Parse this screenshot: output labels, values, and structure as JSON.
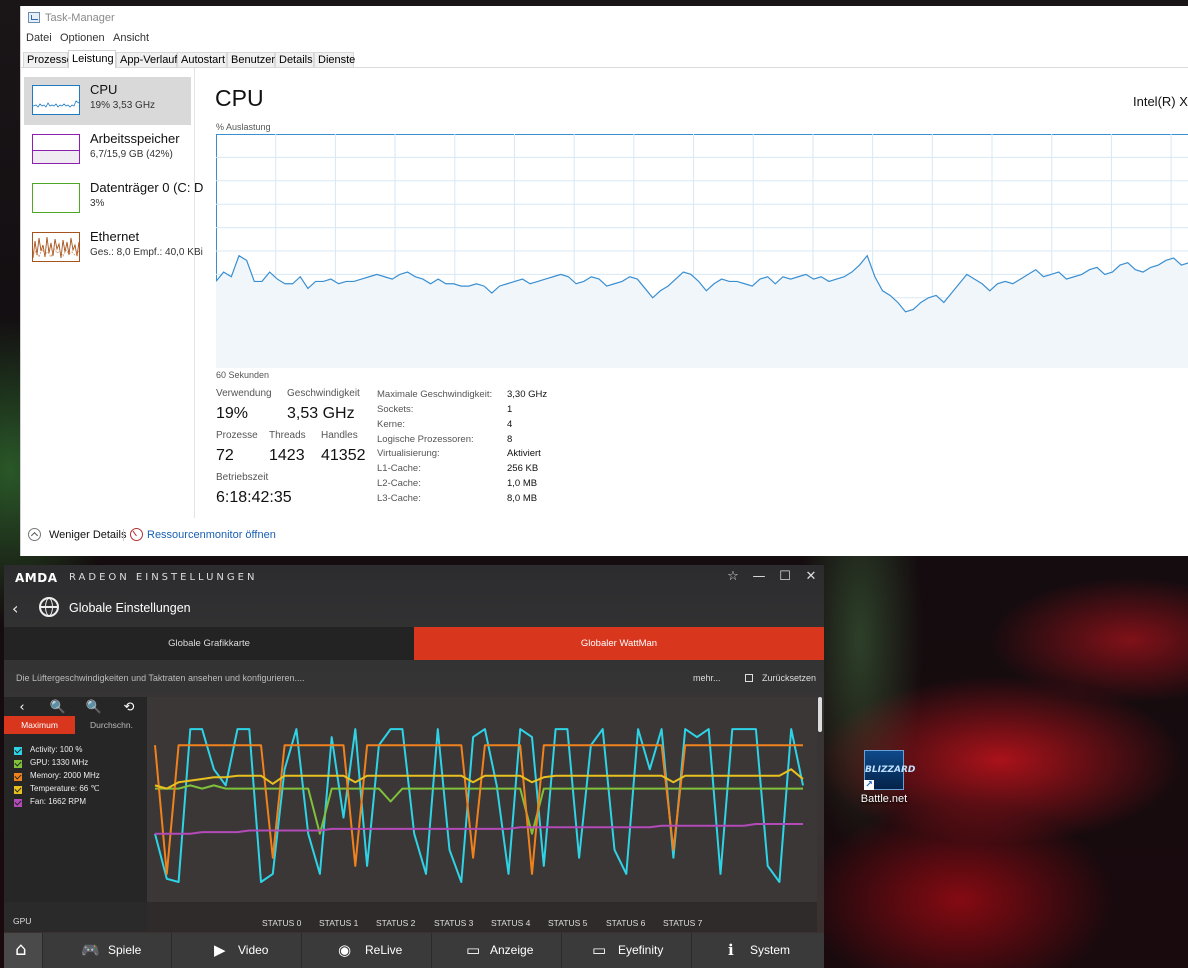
{
  "desktop": {
    "icon_label": "Battle.net",
    "icon_logo_text": "BLIZZARD"
  },
  "taskmanager": {
    "title": "Task-Manager",
    "menu": [
      "Datei",
      "Optionen",
      "Ansicht"
    ],
    "tabs": [
      "Prozesse",
      "Leistung",
      "App-Verlauf",
      "Autostart",
      "Benutzer",
      "Details",
      "Dienste"
    ],
    "active_tab": "Leistung",
    "sidebar": [
      {
        "name": "CPU",
        "sub": "19% 3,53 GHz",
        "color": "#1f7ac6"
      },
      {
        "name": "Arbeitsspeicher",
        "sub": "6,7/15,9 GB (42%)",
        "color": "#8b1fb1"
      },
      {
        "name": "Datenträger 0 (C: D",
        "sub": "3%",
        "color": "#4ea826"
      },
      {
        "name": "Ethernet",
        "sub": "Ges.: 8,0  Empf.: 40,0 KBi",
        "color": "#a6531c"
      }
    ],
    "cpu": {
      "title": "CPU",
      "model": "Intel(R) Xe",
      "y_label": "% Auslastung",
      "x_label": "60 Sekunden",
      "graph_line_color": "#3a8fd1",
      "stats": {
        "usage_label": "Verwendung",
        "usage_value": "19%",
        "speed_label": "Geschwindigkeit",
        "speed_value": "3,53 GHz",
        "processes_label": "Prozesse",
        "processes_value": "72",
        "threads_label": "Threads",
        "threads_value": "1423",
        "handles_label": "Handles",
        "handles_value": "41352",
        "uptime_label": "Betriebszeit",
        "uptime_value": "6:18:42:35"
      },
      "specs": [
        {
          "k": "Maximale Geschwindigkeit:",
          "v": "3,30 GHz"
        },
        {
          "k": "Sockets:",
          "v": "1"
        },
        {
          "k": "Kerne:",
          "v": "4"
        },
        {
          "k": "Logische Prozessoren:",
          "v": "8"
        },
        {
          "k": "Virtualisierung:",
          "v": "Aktiviert"
        },
        {
          "k": "L1-Cache:",
          "v": "256 KB"
        },
        {
          "k": "L2-Cache:",
          "v": "1,0 MB"
        },
        {
          "k": "L3-Cache:",
          "v": "8,0 MB"
        }
      ],
      "history_percent": [
        37,
        41,
        39,
        48,
        46,
        37,
        37,
        41,
        38,
        36,
        36,
        39,
        34,
        37,
        37,
        38,
        36,
        37,
        37,
        38,
        39,
        40,
        39,
        38,
        40,
        41,
        39,
        38,
        36,
        38,
        36,
        36,
        35,
        35,
        36,
        35,
        32,
        35,
        36,
        37,
        38,
        36,
        37,
        38,
        39,
        40,
        39,
        36,
        37,
        39,
        38,
        35,
        36,
        37,
        39,
        38,
        34,
        30,
        33,
        35,
        38,
        41,
        40,
        37,
        33,
        36,
        38,
        37,
        37,
        36,
        35,
        38,
        39,
        36,
        39,
        38,
        39,
        40,
        38,
        39,
        37,
        38,
        39,
        41,
        44,
        48,
        39,
        33,
        31,
        28,
        24,
        25,
        28,
        30,
        31,
        28,
        32,
        36,
        40,
        38,
        36,
        33,
        36,
        37,
        36,
        38,
        40,
        42,
        39,
        40,
        41,
        38,
        39,
        40,
        42,
        43,
        40,
        41,
        44,
        45,
        42,
        41,
        43,
        44,
        46,
        47,
        44,
        45
      ]
    },
    "footer": {
      "fewer_details": "Weniger Details",
      "resource_monitor": "Ressourcenmonitor öffnen"
    }
  },
  "amd": {
    "logo": "AMDA",
    "app_title": "RADEON EINSTELLUNGEN",
    "window_controls": [
      "☆",
      "—",
      "☐",
      "✕"
    ],
    "page_title": "Globale Einstellungen",
    "tabs": [
      {
        "label": "Globale Grafikkarte",
        "active": false
      },
      {
        "label": "Globaler WattMan",
        "active": true
      }
    ],
    "description": "Die Lüftergeschwindigkeiten und Taktraten ansehen und konfigurieren....",
    "more_link": "mehr...",
    "reset_label": "Zurücksetzen",
    "accent_color": "#d9361e",
    "mode_buttons": [
      "Maximum",
      "Durchschn."
    ],
    "legend": [
      {
        "label": "Activity: 100 %",
        "color": "#2ed3e6"
      },
      {
        "label": "GPU: 1330 MHz",
        "color": "#7fc13a"
      },
      {
        "label": "Memory: 2000 MHz",
        "color": "#f0821d"
      },
      {
        "label": "Temperature: 66 ℃",
        "color": "#e8c020"
      },
      {
        "label": "Fan: 1662 RPM",
        "color": "#b24ab8"
      }
    ],
    "gpu_label": "GPU",
    "status_labels": [
      "STATUS 0",
      "STATUS 1",
      "STATUS 2",
      "STATUS 3",
      "STATUS 4",
      "STATUS 5",
      "STATUS 6",
      "STATUS 7"
    ],
    "chart_data": {
      "type": "line",
      "series": [
        {
          "name": "Activity",
          "color": "#2ed3e6",
          "values": [
            30,
            2,
            0,
            95,
            95,
            70,
            60,
            95,
            95,
            0,
            5,
            70,
            95,
            30,
            5,
            90,
            40,
            95,
            10,
            85,
            95,
            95,
            30,
            5,
            95,
            20,
            0,
            90,
            95,
            60,
            5,
            95,
            90,
            10,
            95,
            95,
            15,
            85,
            95,
            20,
            5,
            95,
            70,
            95,
            15,
            95,
            90,
            95,
            5,
            95,
            95,
            95,
            10,
            0,
            95,
            60
          ]
        },
        {
          "name": "GPU",
          "color": "#7fc13a",
          "values": [
            58,
            58,
            58,
            60,
            58,
            60,
            58,
            58,
            58,
            58,
            58,
            58,
            58,
            58,
            30,
            58,
            58,
            58,
            58,
            58,
            50,
            58,
            58,
            58,
            58,
            58,
            58,
            58,
            58,
            58,
            58,
            58,
            30,
            58,
            58,
            58,
            58,
            58,
            58,
            58,
            58,
            58,
            58,
            58,
            58,
            58,
            58,
            58,
            58,
            58,
            58,
            58,
            58,
            58,
            58,
            58
          ]
        },
        {
          "name": "Memory",
          "color": "#f0821d",
          "values": [
            85,
            5,
            85,
            85,
            85,
            85,
            85,
            85,
            85,
            85,
            15,
            85,
            85,
            85,
            85,
            85,
            85,
            10,
            85,
            85,
            85,
            85,
            85,
            85,
            85,
            85,
            85,
            15,
            85,
            85,
            85,
            85,
            5,
            85,
            85,
            85,
            85,
            85,
            85,
            85,
            85,
            85,
            85,
            85,
            20,
            85,
            85,
            85,
            85,
            85,
            85,
            85,
            85,
            85,
            85,
            85
          ]
        },
        {
          "name": "Temperature",
          "color": "#e8c020",
          "values": [
            60,
            58,
            62,
            63,
            64,
            65,
            65,
            66,
            66,
            66,
            61,
            66,
            66,
            66,
            66,
            66,
            66,
            62,
            66,
            66,
            66,
            66,
            66,
            66,
            66,
            66,
            66,
            62,
            66,
            66,
            66,
            66,
            62,
            65,
            66,
            66,
            66,
            66,
            66,
            66,
            66,
            66,
            66,
            66,
            62,
            66,
            66,
            66,
            66,
            66,
            66,
            66,
            66,
            66,
            70,
            64
          ]
        },
        {
          "name": "Fan",
          "color": "#b24ab8",
          "values": [
            30,
            30,
            30,
            30,
            31,
            31,
            31,
            31,
            32,
            32,
            32,
            32,
            32,
            32,
            32,
            33,
            33,
            33,
            33,
            33,
            33,
            33,
            33,
            33,
            33,
            33,
            33,
            33,
            33,
            33,
            33,
            34,
            34,
            34,
            34,
            34,
            34,
            34,
            34,
            34,
            34,
            34,
            34,
            35,
            35,
            35,
            35,
            35,
            35,
            35,
            35,
            36,
            36,
            36,
            36,
            36
          ]
        }
      ],
      "x": "time",
      "ylim": [
        0,
        100
      ]
    },
    "nav": [
      {
        "label": "Spiele",
        "icon": "gamepad-icon",
        "glyph": "🎮"
      },
      {
        "label": "Video",
        "icon": "play-icon",
        "glyph": "▶"
      },
      {
        "label": "ReLive",
        "icon": "relive-icon",
        "glyph": "◉"
      },
      {
        "label": "Anzeige",
        "icon": "monitor-icon",
        "glyph": "▭"
      },
      {
        "label": "Eyefinity",
        "icon": "eyefinity-icon",
        "glyph": "▭"
      },
      {
        "label": "System",
        "icon": "info-icon",
        "glyph": "ℹ"
      }
    ],
    "home_glyph": "⌂"
  }
}
